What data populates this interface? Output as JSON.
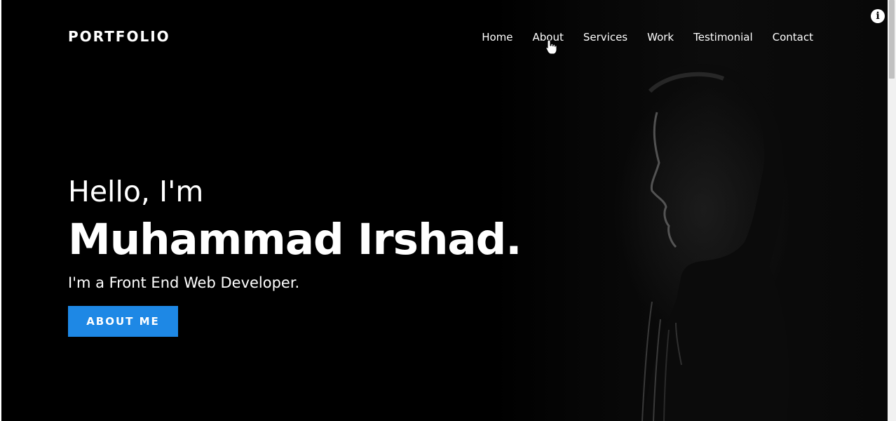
{
  "brand": {
    "logo": "PORTFOLIO"
  },
  "nav": {
    "items": [
      {
        "label": "Home"
      },
      {
        "label": "About"
      },
      {
        "label": "Services"
      },
      {
        "label": "Work"
      },
      {
        "label": "Testimonial"
      },
      {
        "label": "Contact"
      }
    ]
  },
  "hero": {
    "greeting": "Hello, I'm",
    "name": "Muhammad Irshad.",
    "role": "I'm a Front End Web Developer.",
    "cta_label": "ABOUT ME"
  },
  "overlay": {
    "info_icon": "i"
  },
  "colors": {
    "background": "#000000",
    "accent": "#1e88e5",
    "text": "#ffffff"
  },
  "icons": {
    "info": "info-icon",
    "cursor": "hand-pointer-icon"
  }
}
